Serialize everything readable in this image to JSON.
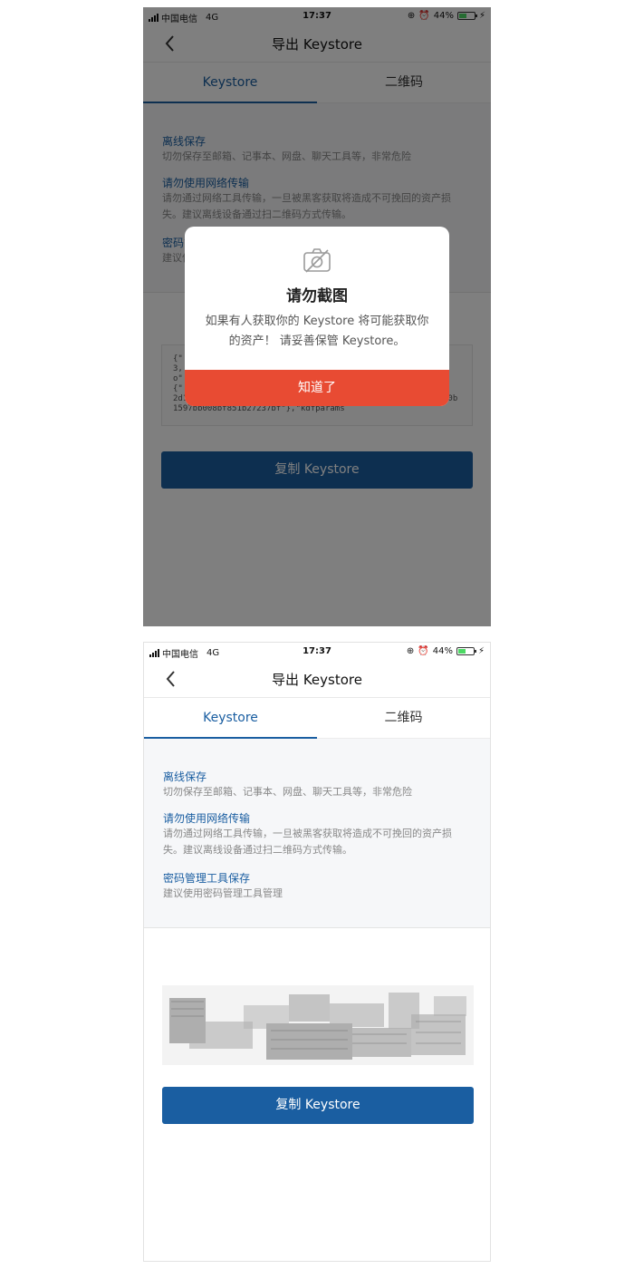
{
  "status": {
    "carrier": "中国电信",
    "network": "4G",
    "time": "17:37",
    "battery": "44%",
    "battery_level": 0.44
  },
  "nav": {
    "title": "导出 Keystore"
  },
  "tabs": [
    {
      "label": "Keystore",
      "active": true
    },
    {
      "label": "二维码",
      "active": false
    }
  ],
  "info": [
    {
      "title": "离线保存",
      "desc": "切勿保存至邮箱、记事本、网盘、聊天工具等，非常危险"
    },
    {
      "title": "请勿使用网络传输",
      "desc": "请勿通过网络工具传输，一旦被黑客获取将造成不可挽回的资产损失。建议离线设备通过扫二维码方式传输。"
    },
    {
      "title": "密码管理工具保存",
      "desc": "建议使用密码管理工具管理"
    }
  ],
  "keystore_text": "{\"\n3,\no\"\n{\"\n2d11b5479aae1565723ea23b\",\"cipherparams\":{\"iv\":\"9f4939c60b1597bb008bf851b27237bf\"},\"kdfparams",
  "copy_button": "复制 Keystore",
  "modal": {
    "icon": "no-camera-icon",
    "title": "请勿截图",
    "desc": "如果有人获取你的 Keystore 将可能获取你的资产！ 请妥善保管 Keystore。",
    "button": "知道了"
  },
  "colors": {
    "accent": "#1a5ea1",
    "danger": "#e84b33",
    "info_bg": "#f6f7f9"
  }
}
